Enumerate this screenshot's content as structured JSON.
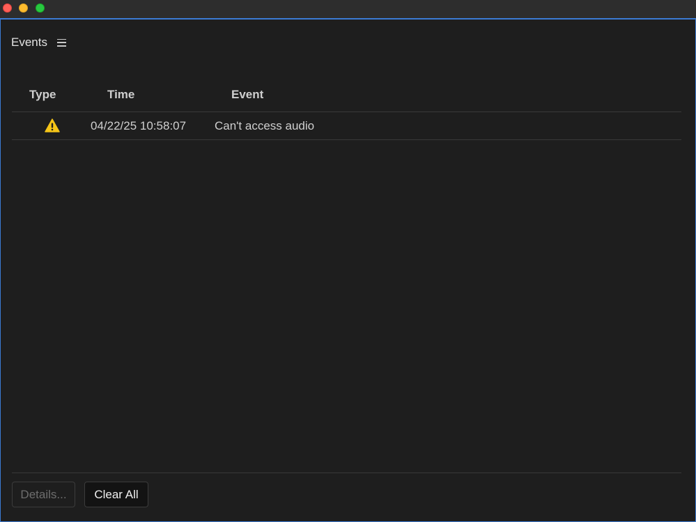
{
  "window": {
    "accent_color": "#3b7bd4",
    "traffic_lights": {
      "close_color": "#ff5f57",
      "minimize_color": "#febc2e",
      "zoom_color": "#28c840"
    }
  },
  "panel": {
    "title": "Events",
    "menu_icon": "hamburger-menu-icon"
  },
  "table": {
    "columns": [
      "Type",
      "Time",
      "Event"
    ],
    "rows": [
      {
        "type_icon": "warning-icon",
        "type_color": "#f5c518",
        "time": "04/22/25 10:58:07",
        "event": "Can't access audio"
      }
    ]
  },
  "buttons": {
    "details_label": "Details...",
    "details_enabled": false,
    "clear_all_label": "Clear All"
  }
}
